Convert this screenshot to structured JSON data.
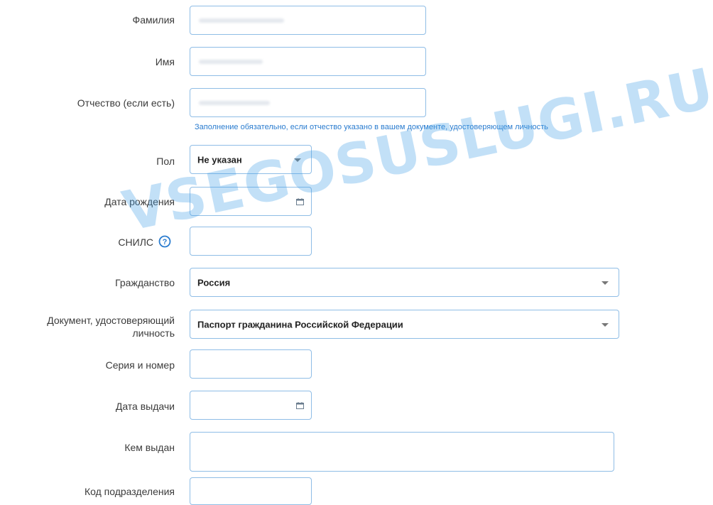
{
  "form": {
    "last_name_label": "Фамилия",
    "first_name_label": "Имя",
    "patronymic_label": "Отчество (если есть)",
    "patronymic_hint": "Заполнение обязательно, если отчество указано в вашем документе, удостоверяющем личность",
    "gender_label": "Пол",
    "gender_value": "Не указан",
    "birth_date_label": "Дата рождения",
    "snils_label": "СНИЛС",
    "citizenship_label": "Гражданство",
    "citizenship_value": "Россия",
    "id_document_label": "Документ, удостоверяющий личность",
    "id_document_value": "Паспорт гражданина Российской Федерации",
    "series_number_label": "Серия и номер",
    "issue_date_label": "Дата выдачи",
    "issued_by_label": "Кем выдан",
    "department_code_label": "Код подразделения"
  },
  "watermark": {
    "text": "VSEGOSUSLUGI.RU"
  },
  "icons": {
    "help": "help-icon",
    "calendar": "calendar-icon",
    "dropdown": "chevron-down-icon"
  },
  "colors": {
    "field_border": "#8fbde6",
    "hint_text": "#2a7ccf",
    "watermark": "#40a0e6"
  }
}
